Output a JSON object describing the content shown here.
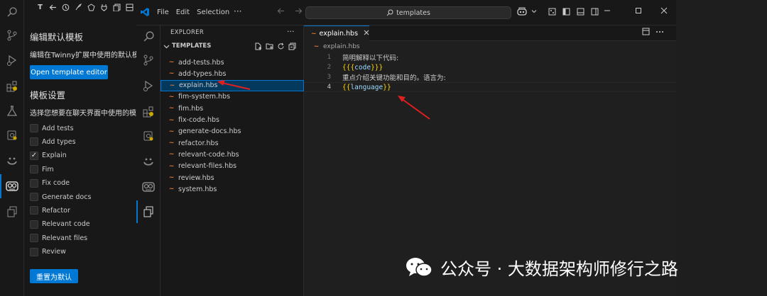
{
  "left_panel": {
    "heading_edit": "编辑默认模板",
    "desc_edit": "编辑在Twinny扩展中使用的默认模板",
    "open_editor_label": "Open template editor",
    "heading_settings": "模板设置",
    "desc_settings": "选择您想要在聊天界面中使用的模板",
    "checkboxes": [
      {
        "label": "Add tests",
        "checked": false
      },
      {
        "label": "Add types",
        "checked": false
      },
      {
        "label": "Explain",
        "checked": true
      },
      {
        "label": "Fim",
        "checked": false
      },
      {
        "label": "Fix code",
        "checked": false
      },
      {
        "label": "Generate docs",
        "checked": false
      },
      {
        "label": "Refactor",
        "checked": false
      },
      {
        "label": "Relevant code",
        "checked": false
      },
      {
        "label": "Relevant files",
        "checked": false
      },
      {
        "label": "Review",
        "checked": false
      }
    ],
    "reset_label": "重置为默认",
    "toolbar_t": "T"
  },
  "window": {
    "menu": [
      "File",
      "Edit",
      "Selection"
    ],
    "menu_more": "···",
    "search_text": "templates",
    "accent": "#0078d4"
  },
  "explorer": {
    "title": "EXPLORER",
    "more": "···",
    "section": "TEMPLATES",
    "files": [
      "add-tests.hbs",
      "add-types.hbs",
      "explain.hbs",
      "fim-system.hbs",
      "fim.hbs",
      "fix-code.hbs",
      "generate-docs.hbs",
      "refactor.hbs",
      "relevant-code.hbs",
      "relevant-files.hbs",
      "review.hbs",
      "system.hbs"
    ],
    "selected_index": 2
  },
  "editor": {
    "tab_label": "explain.hbs",
    "breadcrumb": "explain.hbs",
    "lines": [
      {
        "num": "1",
        "text": "简明解释以下代码:"
      },
      {
        "num": "2",
        "open": "{{{",
        "var": "code",
        "close": "}}}"
      },
      {
        "num": "3",
        "text": "重点介绍关键功能和目的。语言为:"
      },
      {
        "num": "4",
        "open": "{{",
        "var": "language",
        "close": "}}"
      }
    ]
  },
  "watermark": {
    "text": "公众号 · 大数据架构师修行之路"
  },
  "icons": {
    "activity_left": [
      "search-icon",
      "source-control-icon",
      "run-debug-icon",
      "extensions-icon",
      "testing-icon",
      "remote-explorer-icon",
      "smile-icon",
      "twinny-icon",
      "copy-icon"
    ]
  }
}
